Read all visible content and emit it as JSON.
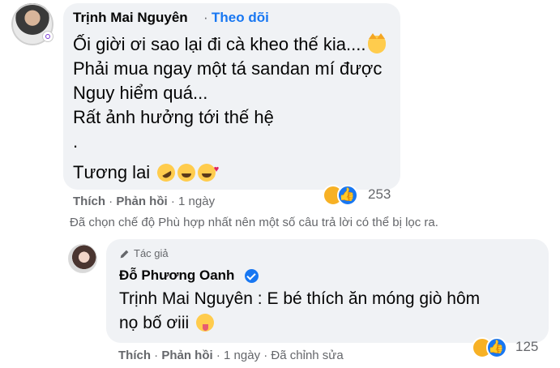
{
  "comment": {
    "author": "Trịnh Mai Nguyên",
    "separator": "·",
    "follow_label": "Theo dõi",
    "lines": [
      "Ối giời ơi sao lại đi cà kheo thế kia....",
      "Phải mua ngay một tá sandan mí được",
      "Nguy hiểm quá...",
      "Rất ảnh hưởng tới thế hệ",
      ".",
      "Tương lai"
    ],
    "reaction_count": "253",
    "actions": {
      "like": "Thích",
      "reply": "Phản hồi",
      "time": "1 ngày"
    }
  },
  "filter_note": "Đã chọn chế độ Phù hợp nhất nên một số câu trả lời có thể bị lọc ra.",
  "reply": {
    "author_tag": "Tác giả",
    "author": "Đỗ Phương Oanh",
    "mention": "Trịnh Mai Nguyên",
    "text_line1": " : E bé thích ăn móng giò hôm",
    "text_line2": "nọ bố ơiii",
    "reaction_count": "125",
    "actions": {
      "like": "Thích",
      "reply": "Phản hồi",
      "time": "1 ngày",
      "edited": "Đã chỉnh sửa"
    }
  },
  "icons": {
    "cat": "weary-cat-emoji",
    "rofl": "rolling-laughing-emoji",
    "grin": "grinning-emoji",
    "hearts": "smiling-hearts-emoji",
    "tongue": "tongue-out-emoji",
    "haha": "haha-reaction",
    "like": "like-reaction",
    "verified": "verified-badge",
    "pencil": "pencil-icon"
  },
  "colors": {
    "bubble": "#f0f2f5",
    "link": "#1877f2",
    "muted": "#65676b",
    "text": "#050505"
  }
}
